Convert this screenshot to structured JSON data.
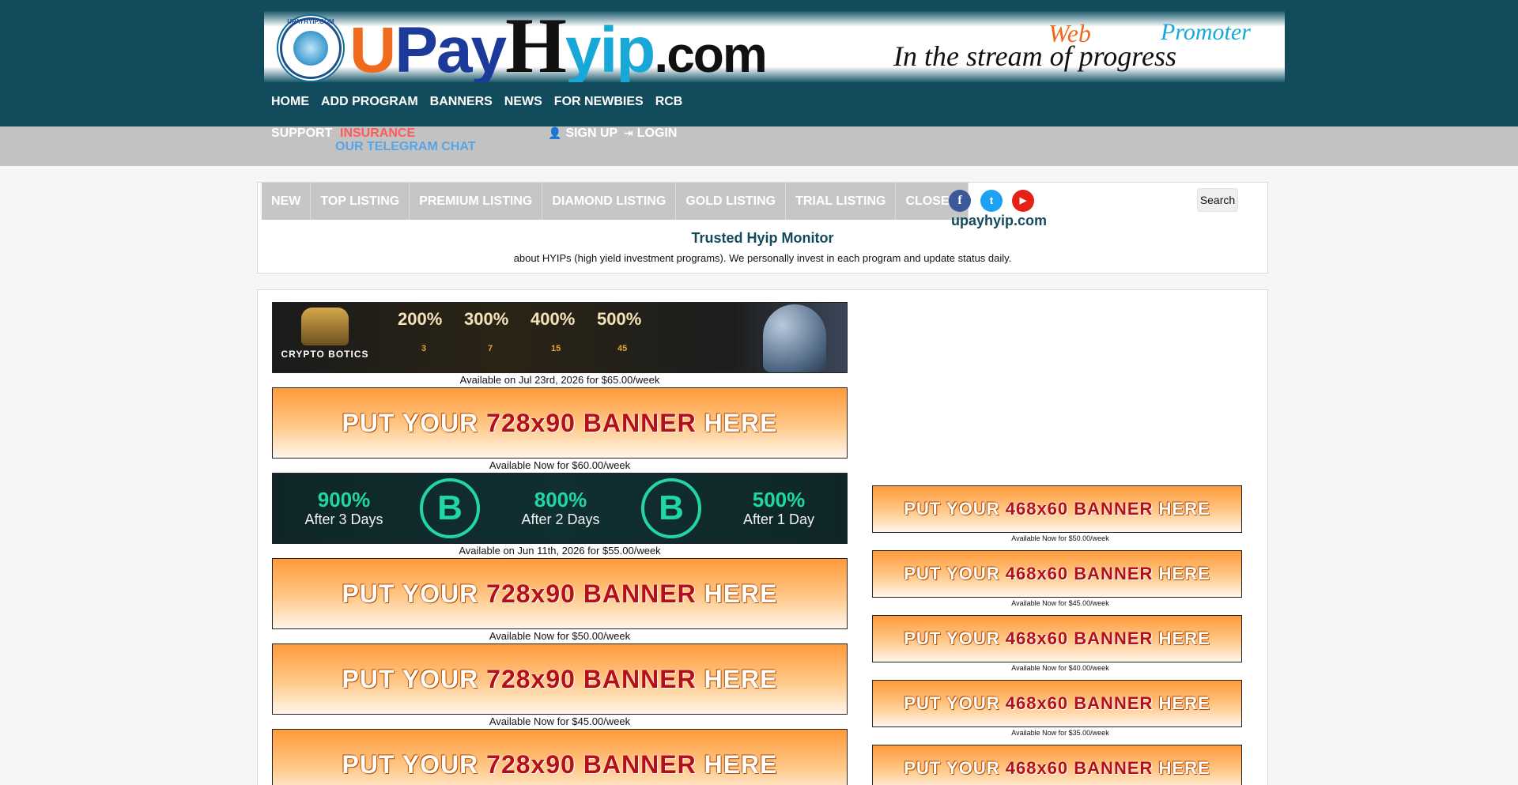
{
  "logo": {
    "seal_text": "UPAYHYIP.COM",
    "u": "U",
    "pay": "Pay",
    "h": "H",
    "yip": "yip",
    "com": ".com",
    "tag_web": "Web",
    "tag_promoter": "Promoter",
    "tag_stream": "In the stream of progress"
  },
  "nav": {
    "items": [
      "HOME",
      "ADD PROGRAM",
      "BANNERS",
      "NEWS",
      "FOR NEWBIES",
      "RCB"
    ],
    "support": "SUPPORT",
    "insurance": "INSURANCE",
    "telegram": "OUR TELEGRAM CHAT",
    "signup": "SIGN UP",
    "login": "LOGIN"
  },
  "tabs": [
    "NEW",
    "TOP LISTING",
    "PREMIUM LISTING",
    "DIAMOND LISTING",
    "GOLD LISTING",
    "TRIAL LISTING",
    "CLOSED"
  ],
  "social": {
    "site": "upayhyip.com",
    "fb": "f",
    "tw": "t",
    "yt": "▶"
  },
  "search_label": "Search",
  "intro": {
    "title": "Trusted Hyip Monitor",
    "subtitle": "about HYIPs (high yield investment programs). We personally invest in each program and update status daily."
  },
  "ads": {
    "crypto": {
      "name": "CRYPTO BOTICS",
      "pcts": [
        "200%",
        "300%",
        "400%",
        "500%"
      ],
      "nums": [
        "3",
        "7",
        "15",
        "45"
      ]
    },
    "btc": {
      "blocks": [
        {
          "value": "900%",
          "sub": "After 3 Days"
        },
        {
          "value": "800%",
          "sub": "After 2 Days"
        },
        {
          "value": "500%",
          "sub": "After 1 Day"
        }
      ],
      "coin": "B"
    },
    "placeholder": {
      "pre": "PUT YOUR",
      "size_big": "728x90",
      "size_small": "468x60",
      "mid": "BANNER",
      "post": "HERE"
    },
    "big_captions": [
      "Available on Jul 23rd, 2026 for $65.00/week",
      "Available Now for $60.00/week",
      "Available on Jun 11th, 2026 for $55.00/week",
      "Available Now for $50.00/week",
      "Available Now for $45.00/week"
    ],
    "small_captions": [
      "Available Now for $50.00/week",
      "Available Now for $45.00/week",
      "Available Now for $40.00/week",
      "Available Now for $35.00/week"
    ]
  }
}
